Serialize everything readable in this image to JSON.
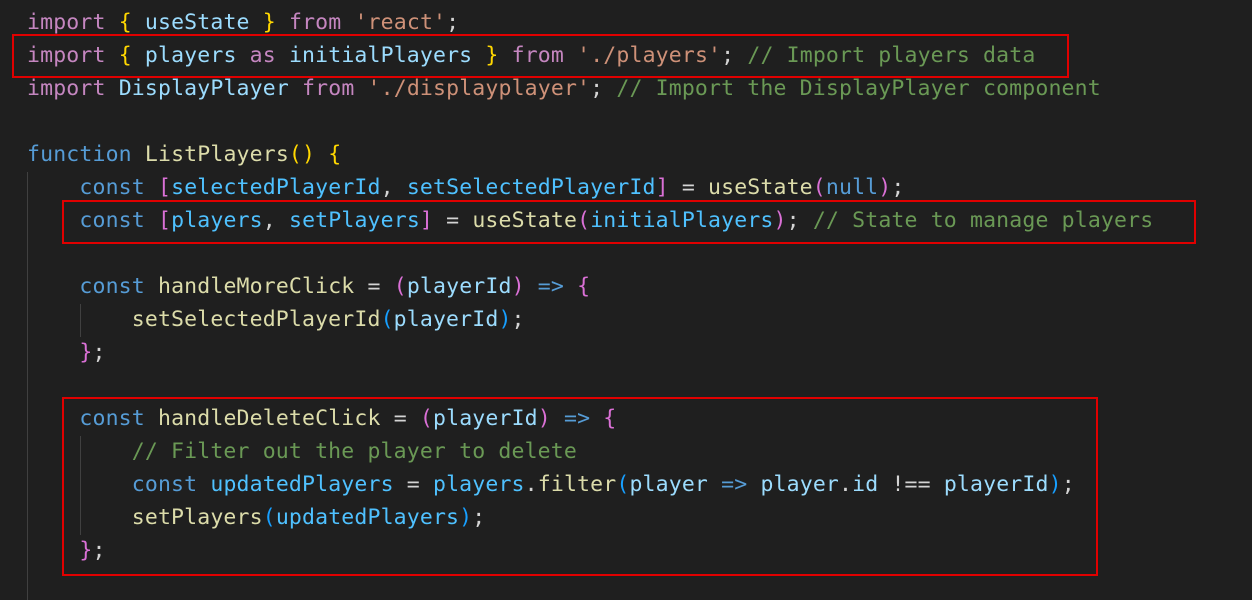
{
  "editor": {
    "theme_colors": {
      "background": "#1f1f1f",
      "keyword_import": "#c586c0",
      "keyword_decl": "#569cd6",
      "identifier": "#9cdcfe",
      "constant": "#4fc1ff",
      "function": "#dcdcaa",
      "string": "#ce9178",
      "comment": "#6a9955",
      "highlight_box": "#e00000"
    },
    "lines": [
      [
        {
          "t": "import",
          "c": "kw-import"
        },
        {
          "t": " "
        },
        {
          "t": "{",
          "c": "b1"
        },
        {
          "t": " useState ",
          "c": "ident"
        },
        {
          "t": "}",
          "c": "b1"
        },
        {
          "t": " "
        },
        {
          "t": "from",
          "c": "kw-import"
        },
        {
          "t": " "
        },
        {
          "t": "'react'",
          "c": "str"
        },
        {
          "t": ";",
          "c": "punct"
        }
      ],
      [
        {
          "t": "import",
          "c": "kw-import"
        },
        {
          "t": " "
        },
        {
          "t": "{",
          "c": "b1"
        },
        {
          "t": " players ",
          "c": "ident"
        },
        {
          "t": "as",
          "c": "kw-import"
        },
        {
          "t": " initialPlayers ",
          "c": "ident"
        },
        {
          "t": "}",
          "c": "b1"
        },
        {
          "t": " "
        },
        {
          "t": "from",
          "c": "kw-import"
        },
        {
          "t": " "
        },
        {
          "t": "'./players'",
          "c": "str"
        },
        {
          "t": ";",
          "c": "punct"
        },
        {
          "t": " "
        },
        {
          "t": "// Import players data",
          "c": "comment"
        }
      ],
      [
        {
          "t": "import",
          "c": "kw-import"
        },
        {
          "t": " "
        },
        {
          "t": "DisplayPlayer",
          "c": "ident"
        },
        {
          "t": " "
        },
        {
          "t": "from",
          "c": "kw-import"
        },
        {
          "t": " "
        },
        {
          "t": "'./displayplayer'",
          "c": "str"
        },
        {
          "t": ";",
          "c": "punct"
        },
        {
          "t": " "
        },
        {
          "t": "// Import the DisplayPlayer component",
          "c": "comment"
        }
      ],
      [],
      [
        {
          "t": "function",
          "c": "kw-decl"
        },
        {
          "t": " "
        },
        {
          "t": "ListPlayers",
          "c": "fn"
        },
        {
          "t": "()",
          "c": "b1"
        },
        {
          "t": " "
        },
        {
          "t": "{",
          "c": "b1"
        }
      ],
      [
        {
          "t": "    "
        },
        {
          "t": "const",
          "c": "kw-decl"
        },
        {
          "t": " "
        },
        {
          "t": "[",
          "c": "b2"
        },
        {
          "t": "selectedPlayerId",
          "c": "const-var"
        },
        {
          "t": ", ",
          "c": "punct"
        },
        {
          "t": "setSelectedPlayerId",
          "c": "const-var"
        },
        {
          "t": "]",
          "c": "b2"
        },
        {
          "t": " = ",
          "c": "op"
        },
        {
          "t": "useState",
          "c": "fn"
        },
        {
          "t": "(",
          "c": "b2"
        },
        {
          "t": "null",
          "c": "null"
        },
        {
          "t": ")",
          "c": "b2"
        },
        {
          "t": ";",
          "c": "punct"
        }
      ],
      [
        {
          "t": "    "
        },
        {
          "t": "const",
          "c": "kw-decl"
        },
        {
          "t": " "
        },
        {
          "t": "[",
          "c": "b2"
        },
        {
          "t": "players",
          "c": "const-var"
        },
        {
          "t": ", ",
          "c": "punct"
        },
        {
          "t": "setPlayers",
          "c": "const-var"
        },
        {
          "t": "]",
          "c": "b2"
        },
        {
          "t": " = ",
          "c": "op"
        },
        {
          "t": "useState",
          "c": "fn"
        },
        {
          "t": "(",
          "c": "b2"
        },
        {
          "t": "initialPlayers",
          "c": "const-var"
        },
        {
          "t": ")",
          "c": "b2"
        },
        {
          "t": ";",
          "c": "punct"
        },
        {
          "t": " "
        },
        {
          "t": "// State to manage players",
          "c": "comment"
        }
      ],
      [],
      [
        {
          "t": "    "
        },
        {
          "t": "const",
          "c": "kw-decl"
        },
        {
          "t": " "
        },
        {
          "t": "handleMoreClick",
          "c": "fn"
        },
        {
          "t": " = ",
          "c": "op"
        },
        {
          "t": "(",
          "c": "b2"
        },
        {
          "t": "playerId",
          "c": "ident"
        },
        {
          "t": ")",
          "c": "b2"
        },
        {
          "t": " "
        },
        {
          "t": "=>",
          "c": "arrow"
        },
        {
          "t": " "
        },
        {
          "t": "{",
          "c": "b2"
        }
      ],
      [
        {
          "t": "        "
        },
        {
          "t": "setSelectedPlayerId",
          "c": "fn"
        },
        {
          "t": "(",
          "c": "b3"
        },
        {
          "t": "playerId",
          "c": "ident"
        },
        {
          "t": ")",
          "c": "b3"
        },
        {
          "t": ";",
          "c": "punct"
        }
      ],
      [
        {
          "t": "    "
        },
        {
          "t": "}",
          "c": "b2"
        },
        {
          "t": ";",
          "c": "punct"
        }
      ],
      [],
      [
        {
          "t": "    "
        },
        {
          "t": "const",
          "c": "kw-decl"
        },
        {
          "t": " "
        },
        {
          "t": "handleDeleteClick",
          "c": "fn"
        },
        {
          "t": " = ",
          "c": "op"
        },
        {
          "t": "(",
          "c": "b2"
        },
        {
          "t": "playerId",
          "c": "ident"
        },
        {
          "t": ")",
          "c": "b2"
        },
        {
          "t": " "
        },
        {
          "t": "=>",
          "c": "arrow"
        },
        {
          "t": " "
        },
        {
          "t": "{",
          "c": "b2"
        }
      ],
      [
        {
          "t": "        "
        },
        {
          "t": "// Filter out the player to delete",
          "c": "comment"
        }
      ],
      [
        {
          "t": "        "
        },
        {
          "t": "const",
          "c": "kw-decl"
        },
        {
          "t": " "
        },
        {
          "t": "updatedPlayers",
          "c": "const-var"
        },
        {
          "t": " = ",
          "c": "op"
        },
        {
          "t": "players",
          "c": "const-var"
        },
        {
          "t": ".",
          "c": "punct"
        },
        {
          "t": "filter",
          "c": "fn"
        },
        {
          "t": "(",
          "c": "b3"
        },
        {
          "t": "player",
          "c": "ident"
        },
        {
          "t": " "
        },
        {
          "t": "=>",
          "c": "arrow"
        },
        {
          "t": " "
        },
        {
          "t": "player",
          "c": "ident"
        },
        {
          "t": ".",
          "c": "punct"
        },
        {
          "t": "id",
          "c": "ident"
        },
        {
          "t": " !== ",
          "c": "op"
        },
        {
          "t": "playerId",
          "c": "ident"
        },
        {
          "t": ")",
          "c": "b3"
        },
        {
          "t": ";",
          "c": "punct"
        }
      ],
      [
        {
          "t": "        "
        },
        {
          "t": "setPlayers",
          "c": "fn"
        },
        {
          "t": "(",
          "c": "b3"
        },
        {
          "t": "updatedPlayers",
          "c": "const-var"
        },
        {
          "t": ")",
          "c": "b3"
        },
        {
          "t": ";",
          "c": "punct"
        }
      ],
      [
        {
          "t": "    "
        },
        {
          "t": "}",
          "c": "b2"
        },
        {
          "t": ";",
          "c": "punct"
        }
      ]
    ],
    "highlighted_sections": [
      {
        "label": "import-players-data"
      },
      {
        "label": "players-state"
      },
      {
        "label": "handle-delete-click"
      }
    ]
  }
}
